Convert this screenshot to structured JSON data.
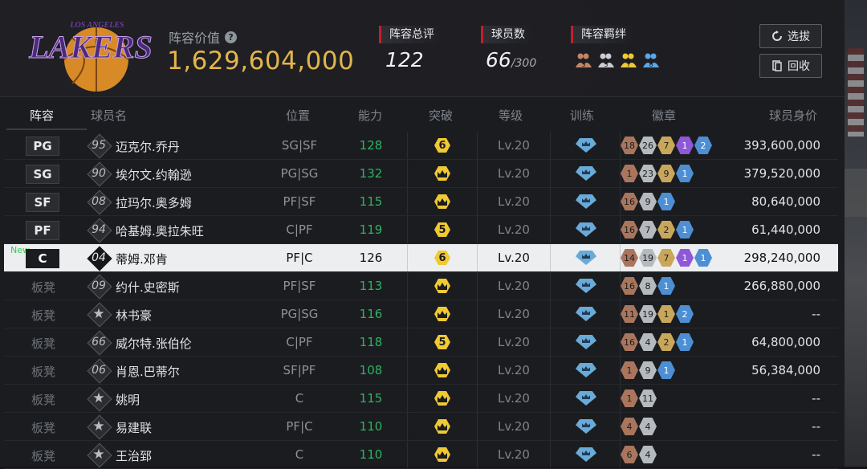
{
  "header": {
    "value_label": "阵容价值",
    "help_icon": "?",
    "value": "1,629,604,000",
    "stats": [
      {
        "label": "阵容总评",
        "value": "122",
        "suffix": ""
      },
      {
        "label": "球员数",
        "value": "66",
        "suffix": "/300"
      },
      {
        "label": "阵容羁绊",
        "value": "",
        "suffix": ""
      }
    ],
    "bond_icons": [
      "3",
      "5",
      "7",
      "8"
    ],
    "buttons": {
      "select": "选拔",
      "recycle": "回收"
    },
    "logo_text": "LAKERS",
    "logo_top": "LOS ANGELES"
  },
  "columns": {
    "lineup": "阵容",
    "name": "球员名",
    "position": "位置",
    "ability": "能力",
    "breakthrough": "突破",
    "level": "等级",
    "training": "训练",
    "badges": "徽章",
    "price": "球员身价"
  },
  "rows": [
    {
      "slot": "PG",
      "bench": false,
      "jersey": "95",
      "star": false,
      "name": "迈克尔.乔丹",
      "pos": "SG|SF",
      "ability": "128",
      "brk": "6",
      "lvl": "Lv.20",
      "badges": [
        [
          "18",
          "bronze"
        ],
        [
          "26",
          "silver"
        ],
        [
          "7",
          "gold"
        ],
        [
          "1",
          "purple"
        ],
        [
          "2",
          "blue"
        ]
      ],
      "price": "393,600,000"
    },
    {
      "slot": "SG",
      "bench": false,
      "jersey": "90",
      "star": false,
      "name": "埃尔文.约翰逊",
      "pos": "PG|SG",
      "ability": "132",
      "brk": "crown",
      "lvl": "Lv.20",
      "badges": [
        [
          "1",
          "bronze"
        ],
        [
          "23",
          "silver"
        ],
        [
          "9",
          "gold"
        ],
        [
          "1",
          "blue"
        ]
      ],
      "price": "379,520,000"
    },
    {
      "slot": "SF",
      "bench": false,
      "jersey": "08",
      "star": false,
      "name": "拉玛尔.奥多姆",
      "pos": "PF|SF",
      "ability": "115",
      "brk": "crown",
      "lvl": "Lv.20",
      "badges": [
        [
          "16",
          "bronze"
        ],
        [
          "9",
          "silver"
        ],
        [
          "1",
          "blue"
        ]
      ],
      "price": "80,640,000"
    },
    {
      "slot": "PF",
      "bench": false,
      "jersey": "94",
      "star": false,
      "name": "哈基姆.奥拉朱旺",
      "pos": "C|PF",
      "ability": "119",
      "brk": "5",
      "lvl": "Lv.20",
      "badges": [
        [
          "16",
          "bronze"
        ],
        [
          "7",
          "silver"
        ],
        [
          "2",
          "gold"
        ],
        [
          "1",
          "blue"
        ]
      ],
      "price": "61,440,000"
    },
    {
      "slot": "C",
      "bench": false,
      "new": "New",
      "jersey": "04",
      "star": false,
      "name": "蒂姆.邓肯",
      "pos": "PF|C",
      "ability": "126",
      "brk": "6",
      "lvl": "Lv.20",
      "badges": [
        [
          "14",
          "bronze"
        ],
        [
          "19",
          "silver"
        ],
        [
          "7",
          "gold"
        ],
        [
          "1",
          "purple"
        ],
        [
          "1",
          "blue"
        ]
      ],
      "price": "298,240,000",
      "selected": true
    },
    {
      "slot": "板凳",
      "bench": true,
      "jersey": "09",
      "star": false,
      "name": "约什.史密斯",
      "pos": "PF|SF",
      "ability": "113",
      "brk": "crown",
      "lvl": "Lv.20",
      "badges": [
        [
          "16",
          "bronze"
        ],
        [
          "8",
          "silver"
        ],
        [
          "1",
          "blue"
        ]
      ],
      "price": "266,880,000"
    },
    {
      "slot": "板凳",
      "bench": true,
      "jersey": "",
      "star": true,
      "name": "林书豪",
      "pos": "PG|SG",
      "ability": "116",
      "brk": "crown",
      "lvl": "Lv.20",
      "badges": [
        [
          "11",
          "bronze"
        ],
        [
          "19",
          "silver"
        ],
        [
          "1",
          "gold"
        ],
        [
          "2",
          "blue"
        ]
      ],
      "price": "--"
    },
    {
      "slot": "板凳",
      "bench": true,
      "jersey": "66",
      "star": false,
      "name": "威尔特.张伯伦",
      "pos": "C|PF",
      "ability": "118",
      "brk": "5",
      "lvl": "Lv.20",
      "badges": [
        [
          "16",
          "bronze"
        ],
        [
          "4",
          "silver"
        ],
        [
          "2",
          "gold"
        ],
        [
          "1",
          "blue"
        ]
      ],
      "price": "64,800,000"
    },
    {
      "slot": "板凳",
      "bench": true,
      "jersey": "06",
      "star": false,
      "name": "肖恩.巴蒂尔",
      "pos": "SF|PF",
      "ability": "108",
      "brk": "crown",
      "lvl": "Lv.20",
      "badges": [
        [
          "1",
          "bronze"
        ],
        [
          "9",
          "silver"
        ],
        [
          "1",
          "blue"
        ]
      ],
      "price": "56,384,000"
    },
    {
      "slot": "板凳",
      "bench": true,
      "jersey": "",
      "star": true,
      "name": "姚明",
      "pos": "C",
      "ability": "115",
      "brk": "crown",
      "lvl": "Lv.20",
      "badges": [
        [
          "1",
          "bronze"
        ],
        [
          "11",
          "silver"
        ]
      ],
      "price": "--"
    },
    {
      "slot": "板凳",
      "bench": true,
      "jersey": "",
      "star": true,
      "name": "易建联",
      "pos": "PF|C",
      "ability": "110",
      "brk": "crown",
      "lvl": "Lv.20",
      "badges": [
        [
          "4",
          "bronze"
        ],
        [
          "4",
          "silver"
        ]
      ],
      "price": "--"
    },
    {
      "slot": "板凳",
      "bench": true,
      "jersey": "",
      "star": true,
      "name": "王治郅",
      "pos": "C",
      "ability": "110",
      "brk": "crown",
      "lvl": "Lv.20",
      "badges": [
        [
          "6",
          "bronze"
        ],
        [
          "4",
          "silver"
        ]
      ],
      "price": "--"
    }
  ]
}
